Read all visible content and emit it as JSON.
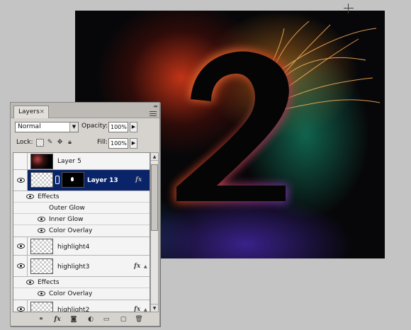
{
  "canvas": {
    "artwork_glyph": "2"
  },
  "panel": {
    "tab_label": "Layers",
    "tab_close": "×",
    "collapse_glyph": "◂◂",
    "blend_mode": "Normal",
    "opacity_label": "Opacity:",
    "opacity_value": "100%",
    "lock_label": "Lock:",
    "fill_label": "Fill:",
    "fill_value": "100%",
    "layers": {
      "layer5": {
        "name": "Layer 5"
      },
      "layer13": {
        "name": "Layer 13",
        "fx": "fx",
        "effects_label": "Effects",
        "effects": [
          "Outer Glow",
          "Inner Glow",
          "Color Overlay"
        ]
      },
      "highlight4": {
        "name": "highlight4"
      },
      "highlight3": {
        "name": "highlight3",
        "fx": "fx",
        "effects_label": "Effects",
        "effects": [
          "Color Overlay"
        ]
      },
      "highlight2": {
        "name": "highlight2",
        "fx": "fx"
      }
    },
    "toolbar": {
      "link_icon": "⚭",
      "fx_icon": "fx",
      "mask_icon": "◙",
      "adjustment_icon": "◐",
      "group_icon": "▭",
      "new_layer_icon": "▢",
      "delete_icon": "🗑"
    }
  },
  "colors": {
    "selection": "#0a246a",
    "panel_bg": "#d6d3ce",
    "app_bg": "#c4c4c4"
  }
}
